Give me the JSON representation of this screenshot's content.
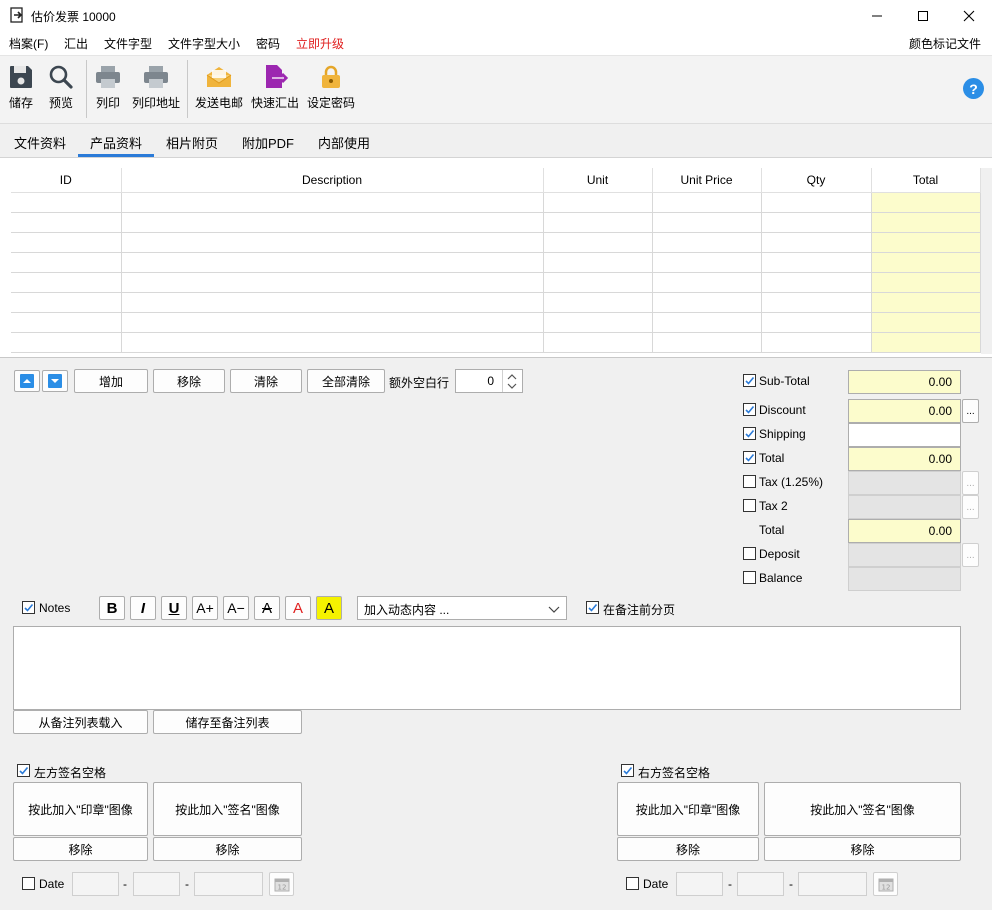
{
  "window": {
    "title": "估价发票 10000"
  },
  "menu": {
    "items": [
      "档案(F)",
      "汇出",
      "文件字型",
      "文件字型大小",
      "密码"
    ],
    "upgrade": "立即升级",
    "right": "颜色标记文件"
  },
  "toolbar": {
    "save": "储存",
    "preview": "预览",
    "print": "列印",
    "print_address": "列印地址",
    "send_email": "发送电邮",
    "quick_export": "快速汇出",
    "set_password": "设定密码"
  },
  "tabs": [
    "文件资料",
    "产品资料",
    "相片附页",
    "附加PDF",
    "内部使用"
  ],
  "grid": {
    "columns": [
      "ID",
      "Description",
      "Unit",
      "Unit Price",
      "Qty",
      "Total"
    ],
    "row_count": 8
  },
  "row_actions": {
    "add": "增加",
    "remove": "移除",
    "clear": "清除",
    "clear_all": "全部清除",
    "extra_blank_rows_label": "额外空白行",
    "extra_blank_rows_value": "0"
  },
  "totals": {
    "subtotal_label": "Sub-Total",
    "subtotal_value": "0.00",
    "discount_label": "Discount",
    "discount_value": "0.00",
    "shipping_label": "Shipping",
    "shipping_value": "",
    "total_label": "Total",
    "total_value": "0.00",
    "tax_label": "Tax (1.25%)",
    "tax2_label": "Tax 2",
    "grand_total_label": "Total",
    "grand_total_value": "0.00",
    "deposit_label": "Deposit",
    "balance_label": "Balance",
    "ellipsis": "..."
  },
  "notes": {
    "label": "Notes",
    "dynamic_placeholder": "加入动态内容 ...",
    "page_break_label": "在备注前分页",
    "load_from_list": "从备注列表载入",
    "save_to_list": "储存至备注列表",
    "format": {
      "bold": "B",
      "italic": "I",
      "underline": "U",
      "grow": "A+",
      "shrink": "A−",
      "strike": "A",
      "color": "A",
      "highlight": "A"
    }
  },
  "signature_left": {
    "label": "左方签名空格",
    "stamp_btn": "按此加入\"印章\"图像",
    "sign_btn": "按此加入\"签名\"图像",
    "remove": "移除",
    "date_label": "Date",
    "dash": "-"
  },
  "signature_right": {
    "label": "右方签名空格",
    "stamp_btn": "按此加入\"印章\"图像",
    "sign_btn": "按此加入\"签名\"图像",
    "remove": "移除",
    "date_label": "Date",
    "dash": "-"
  },
  "colors": {
    "accent": "#2b7bd8",
    "upgrade": "#e0201f",
    "yellow_field": "#fcfccc",
    "email_icon": "#f0b43c",
    "export_icon": "#9c27b0",
    "lock_icon": "#f0b43c"
  }
}
